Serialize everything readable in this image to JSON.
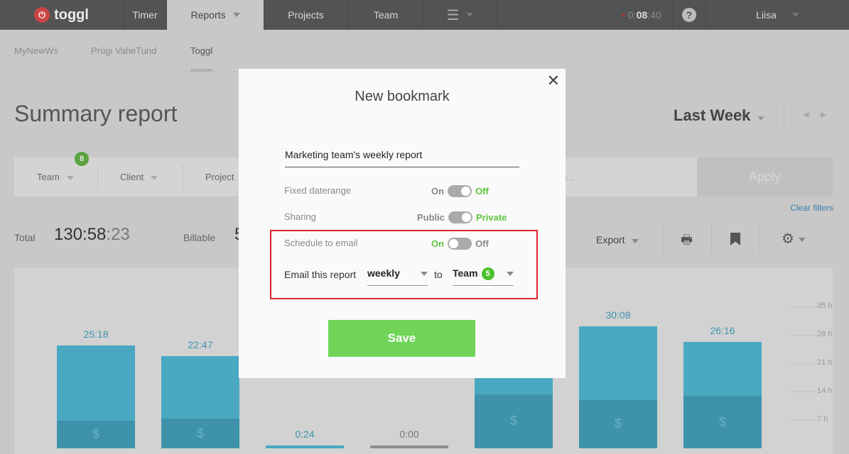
{
  "nav": {
    "logo": "toggl",
    "items": [
      "Timer",
      "Reports",
      "Projects",
      "Team"
    ],
    "timer": {
      "dim": "0:",
      "bold": "08",
      "rest": ":40"
    },
    "user": "Liisa"
  },
  "workspaces": [
    "MyNewWs",
    "Prügi VaheTund",
    "Toggl"
  ],
  "page": {
    "title": "Summary report",
    "period": "Last Week"
  },
  "filters": {
    "team": "Team",
    "team_count": "8",
    "client": "Client",
    "project": "Project",
    "search_tail": "n...",
    "apply": "Apply",
    "clear": "Clear filters"
  },
  "totals": {
    "total_label": "Total",
    "total_main": "130:58",
    "total_sec": ":23",
    "billable_label": "Billable",
    "billable_partial": "5"
  },
  "toolbar": {
    "export": "Export"
  },
  "chart_data": {
    "type": "bar",
    "stacked": true,
    "yticks": [
      "35 h",
      "28 h",
      "21 h",
      "14 h",
      "7 h"
    ],
    "ylim": [
      0,
      35
    ],
    "bars": [
      {
        "label": "25:18",
        "total": 25.3,
        "billable": 6.8
      },
      {
        "label": "22:47",
        "total": 22.78,
        "billable": 7.3
      },
      {
        "label": "0:24",
        "total": 0.4,
        "billable": 0
      },
      {
        "label": "0:00",
        "total": 0,
        "billable": 0
      },
      {
        "label": "",
        "total": null,
        "billable": 13.3
      },
      {
        "label": "30:08",
        "total": 30.13,
        "billable": 11.9
      },
      {
        "label": "26:16",
        "total": 26.27,
        "billable": 12.9
      }
    ],
    "colors": {
      "total": "#4aa8c2",
      "billable": "#3e93ab"
    }
  },
  "modal": {
    "title": "New bookmark",
    "name": "Marketing team's weekly report",
    "fixed": {
      "label": "Fixed daterange",
      "on": "On",
      "off": "Off"
    },
    "sharing": {
      "label": "Sharing",
      "on": "Public",
      "off": "Private"
    },
    "schedule": {
      "label": "Schedule to email",
      "on": "On",
      "off": "Off"
    },
    "email": {
      "label": "Email this report",
      "freq": "weekly",
      "to": "to",
      "target": "Team",
      "count": "5"
    },
    "save": "Save"
  }
}
